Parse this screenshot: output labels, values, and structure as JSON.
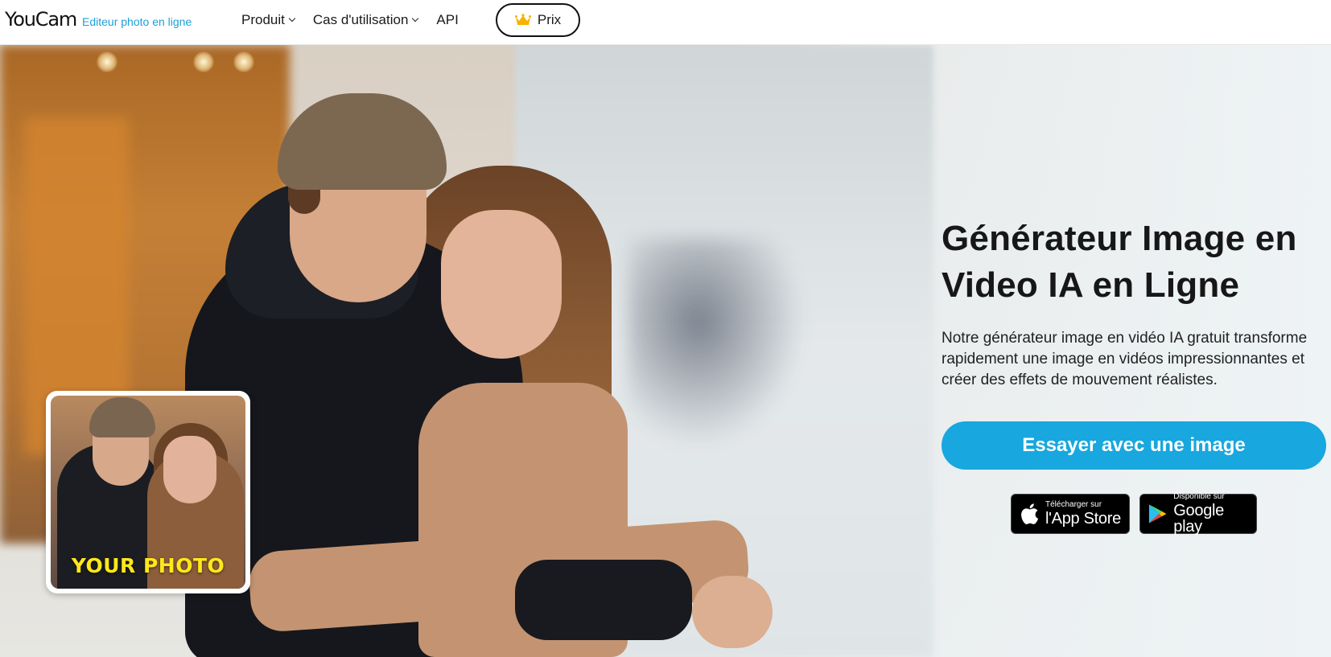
{
  "brand": {
    "name": "YouCam",
    "subtitle": "Editeur photo en ligne"
  },
  "nav": {
    "items": [
      {
        "label": "Produit",
        "has_dropdown": true
      },
      {
        "label": "Cas d'utilisation",
        "has_dropdown": true
      },
      {
        "label": "API",
        "has_dropdown": false
      }
    ],
    "price_label": "Prix",
    "price_icon": "crown-icon"
  },
  "hero": {
    "thumbnail_label": "YOUR PHOTO",
    "title_line1": "Générateur Image en",
    "title_line2": "Video IA en Ligne",
    "description": "Notre générateur image en vidéo IA gratuit transforme rapidement une image en vidéos impressionnantes et créer des effets de mouvement réalistes.",
    "cta_label": "Essayer avec une image"
  },
  "stores": {
    "apple": {
      "small": "Télécharger sur",
      "big": "l'App Store",
      "icon": "apple-icon"
    },
    "google": {
      "small": "Disponible sur",
      "big": "Google play",
      "icon": "google-play-icon"
    }
  },
  "colors": {
    "accent": "#18a7de",
    "brand_sub": "#1aa0d8",
    "crown": "#f5b400",
    "thumb_label": "#ffe81a"
  }
}
